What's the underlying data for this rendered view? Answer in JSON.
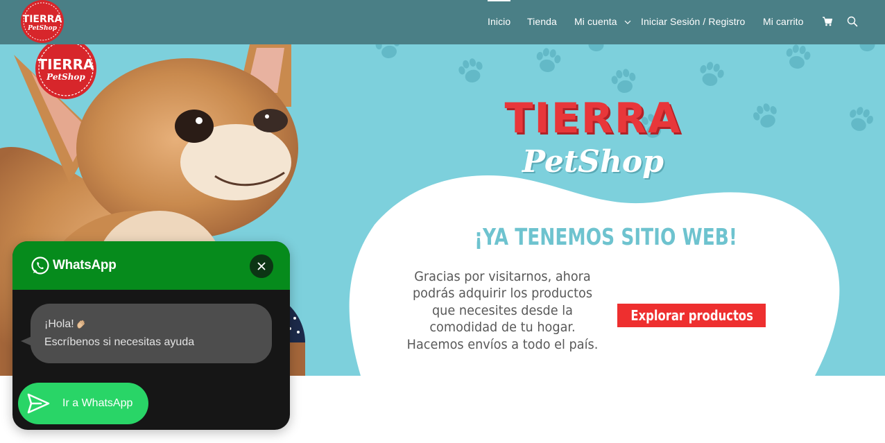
{
  "header": {
    "logo_text": "TIERRA",
    "logo_subtext": "PetShop",
    "nav": [
      {
        "label": "Inicio"
      },
      {
        "label": "Tienda"
      },
      {
        "label": "Mi cuenta"
      },
      {
        "label": "Iniciar Sesión / Registro"
      },
      {
        "label": "Mi carrito"
      }
    ],
    "icons": [
      "cart-icon",
      "search-icon"
    ]
  },
  "hero": {
    "brand_line1": "TIERRA",
    "brand_line2": "PetShop",
    "heading": "¡YA TENEMOS SITIO WEB!",
    "paragraph_lines": [
      "Gracias por visitarnos, ahora",
      "podrás adquirir los productos",
      "que necesites desde la",
      "comodidad de tu hogar.",
      "Hacemos envíos a todo el país."
    ],
    "button_label": "Explorar productos",
    "colors": {
      "background": "#7dd0dc",
      "button": "#ee2f2f",
      "brand": "#e8373a"
    }
  },
  "whatsapp": {
    "title": "WhatsApp",
    "greeting": "¡Hola!",
    "message": "Escríbenos si necesitas ayuda",
    "button_label": "Ir a WhatsApp",
    "colors": {
      "header": "#068b1c",
      "button": "#29d567"
    }
  }
}
